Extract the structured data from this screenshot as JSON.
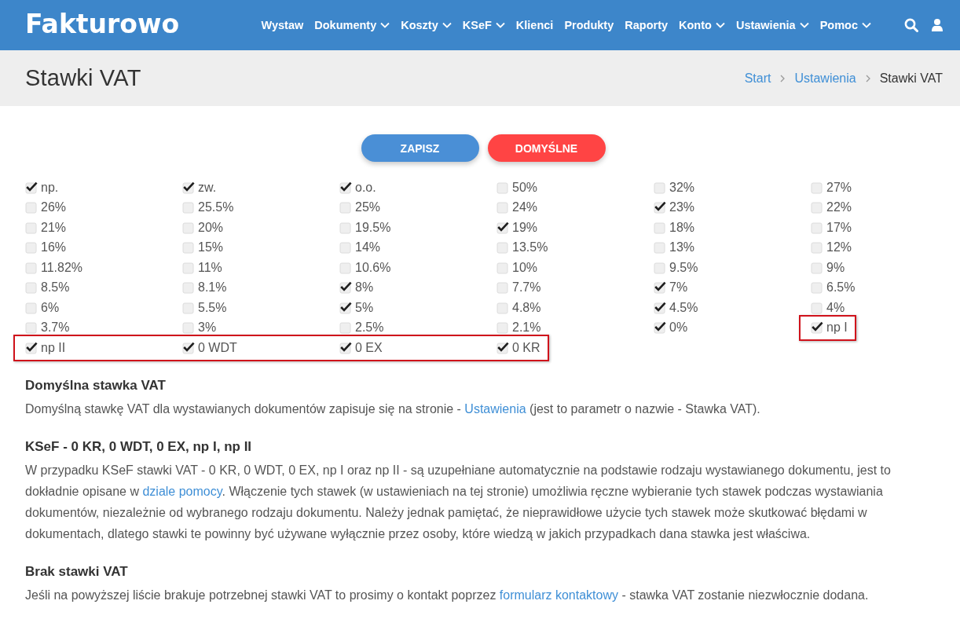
{
  "navbar": {
    "logo": "Fakturowo",
    "menu": [
      {
        "label": "Wystaw",
        "has_dropdown": false
      },
      {
        "label": "Dokumenty",
        "has_dropdown": true
      },
      {
        "label": "Koszty",
        "has_dropdown": true
      },
      {
        "label": "KSeF",
        "has_dropdown": true
      },
      {
        "label": "Klienci",
        "has_dropdown": false
      },
      {
        "label": "Produkty",
        "has_dropdown": false
      },
      {
        "label": "Raporty",
        "has_dropdown": false
      },
      {
        "label": "Konto",
        "has_dropdown": true
      },
      {
        "label": "Ustawienia",
        "has_dropdown": true
      },
      {
        "label": "Pomoc",
        "has_dropdown": true
      }
    ]
  },
  "header": {
    "title": "Stawki VAT",
    "breadcrumbs": [
      {
        "label": "Start",
        "kind": "link"
      },
      {
        "label": "Ustawienia",
        "kind": "link"
      },
      {
        "label": "Stawki VAT",
        "kind": "current"
      }
    ]
  },
  "actions": [
    {
      "label": "ZAPISZ",
      "kind": "primary"
    },
    {
      "label": "DOMYŚLNE",
      "kind": "danger"
    }
  ],
  "rates": [
    {
      "cells": [
        {
          "label": "np.",
          "checked": true,
          "highlighted": false
        },
        {
          "label": "zw.",
          "checked": true,
          "highlighted": false
        },
        {
          "label": "o.o.",
          "checked": true,
          "highlighted": false
        },
        {
          "label": "50%",
          "checked": false,
          "highlighted": false
        },
        {
          "label": "32%",
          "checked": false,
          "highlighted": false
        },
        {
          "label": "27%",
          "checked": false,
          "highlighted": false
        }
      ]
    },
    {
      "cells": [
        {
          "label": "26%",
          "checked": false,
          "highlighted": false
        },
        {
          "label": "25.5%",
          "checked": false,
          "highlighted": false
        },
        {
          "label": "25%",
          "checked": false,
          "highlighted": false
        },
        {
          "label": "24%",
          "checked": false,
          "highlighted": false
        },
        {
          "label": "23%",
          "checked": true,
          "highlighted": false
        },
        {
          "label": "22%",
          "checked": false,
          "highlighted": false
        }
      ]
    },
    {
      "cells": [
        {
          "label": "21%",
          "checked": false,
          "highlighted": false
        },
        {
          "label": "20%",
          "checked": false,
          "highlighted": false
        },
        {
          "label": "19.5%",
          "checked": false,
          "highlighted": false
        },
        {
          "label": "19%",
          "checked": true,
          "highlighted": false
        },
        {
          "label": "18%",
          "checked": false,
          "highlighted": false
        },
        {
          "label": "17%",
          "checked": false,
          "highlighted": false
        }
      ]
    },
    {
      "cells": [
        {
          "label": "16%",
          "checked": false,
          "highlighted": false
        },
        {
          "label": "15%",
          "checked": false,
          "highlighted": false
        },
        {
          "label": "14%",
          "checked": false,
          "highlighted": false
        },
        {
          "label": "13.5%",
          "checked": false,
          "highlighted": false
        },
        {
          "label": "13%",
          "checked": false,
          "highlighted": false
        },
        {
          "label": "12%",
          "checked": false,
          "highlighted": false
        }
      ]
    },
    {
      "cells": [
        {
          "label": "11.82%",
          "checked": false,
          "highlighted": false
        },
        {
          "label": "11%",
          "checked": false,
          "highlighted": false
        },
        {
          "label": "10.6%",
          "checked": false,
          "highlighted": false
        },
        {
          "label": "10%",
          "checked": false,
          "highlighted": false
        },
        {
          "label": "9.5%",
          "checked": false,
          "highlighted": false
        },
        {
          "label": "9%",
          "checked": false,
          "highlighted": false
        }
      ]
    },
    {
      "cells": [
        {
          "label": "8.5%",
          "checked": false,
          "highlighted": false
        },
        {
          "label": "8.1%",
          "checked": false,
          "highlighted": false
        },
        {
          "label": "8%",
          "checked": true,
          "highlighted": false
        },
        {
          "label": "7.7%",
          "checked": false,
          "highlighted": false
        },
        {
          "label": "7%",
          "checked": true,
          "highlighted": false
        },
        {
          "label": "6.5%",
          "checked": false,
          "highlighted": false
        }
      ]
    },
    {
      "cells": [
        {
          "label": "6%",
          "checked": false,
          "highlighted": false
        },
        {
          "label": "5.5%",
          "checked": false,
          "highlighted": false
        },
        {
          "label": "5%",
          "checked": true,
          "highlighted": false
        },
        {
          "label": "4.8%",
          "checked": false,
          "highlighted": false
        },
        {
          "label": "4.5%",
          "checked": true,
          "highlighted": false
        },
        {
          "label": "4%",
          "checked": false,
          "highlighted": false
        }
      ]
    },
    {
      "cells": [
        {
          "label": "3.7%",
          "checked": false,
          "highlighted": false
        },
        {
          "label": "3%",
          "checked": false,
          "highlighted": false
        },
        {
          "label": "2.5%",
          "checked": false,
          "highlighted": false
        },
        {
          "label": "2.1%",
          "checked": false,
          "highlighted": false
        },
        {
          "label": "0%",
          "checked": true,
          "highlighted": false
        },
        {
          "label": "np I",
          "checked": true,
          "highlighted": true
        }
      ]
    },
    {
      "cells": [
        {
          "label": "np II",
          "checked": true,
          "highlighted": true
        },
        {
          "label": "0 WDT",
          "checked": true,
          "highlighted": true
        },
        {
          "label": "0 EX",
          "checked": true,
          "highlighted": true
        },
        {
          "label": "0 KR",
          "checked": true,
          "highlighted": true
        }
      ]
    }
  ],
  "sections": [
    {
      "heading": "Domyślna stawka VAT",
      "paragraph": [
        {
          "kind": "text",
          "text": "Domyślną stawkę VAT dla wystawianych dokumentów zapisuje się na stronie - "
        },
        {
          "kind": "link",
          "text": "Ustawienia"
        },
        {
          "kind": "text",
          "text": " (jest to parametr o nazwie - Stawka VAT)."
        }
      ]
    },
    {
      "heading": "KSeF - 0 KR, 0 WDT, 0 EX, np I, np II",
      "paragraph": [
        {
          "kind": "text",
          "text": "W przypadku KSeF stawki VAT - 0 KR, 0 WDT, 0 EX, np I oraz np II - są uzupełniane automatycznie na podstawie rodzaju wystawianego dokumentu, jest to dokładnie opisane w "
        },
        {
          "kind": "link",
          "text": "dziale pomocy"
        },
        {
          "kind": "text",
          "text": ". Włączenie tych stawek (w ustawieniach na tej stronie) umożliwia ręczne wybieranie tych stawek podczas wystawiania dokumentów, niezależnie od wybranego rodzaju dokumentu. Należy jednak pamiętać, że nieprawidłowe użycie tych stawek może skutkować błędami w dokumentach, dlatego stawki te powinny być używane wyłącznie przez osoby, które wiedzą w jakich przypadkach dana stawka jest właściwa."
        }
      ]
    },
    {
      "heading": "Brak stawki VAT",
      "paragraph": [
        {
          "kind": "text",
          "text": "Jeśli na powyższej liście brakuje potrzebnej stawki VAT to prosimy o kontakt poprzez "
        },
        {
          "kind": "link",
          "text": "formularz kontaktowy"
        },
        {
          "kind": "text",
          "text": " - stawka VAT zostanie niezwłocznie dodana."
        }
      ]
    }
  ]
}
